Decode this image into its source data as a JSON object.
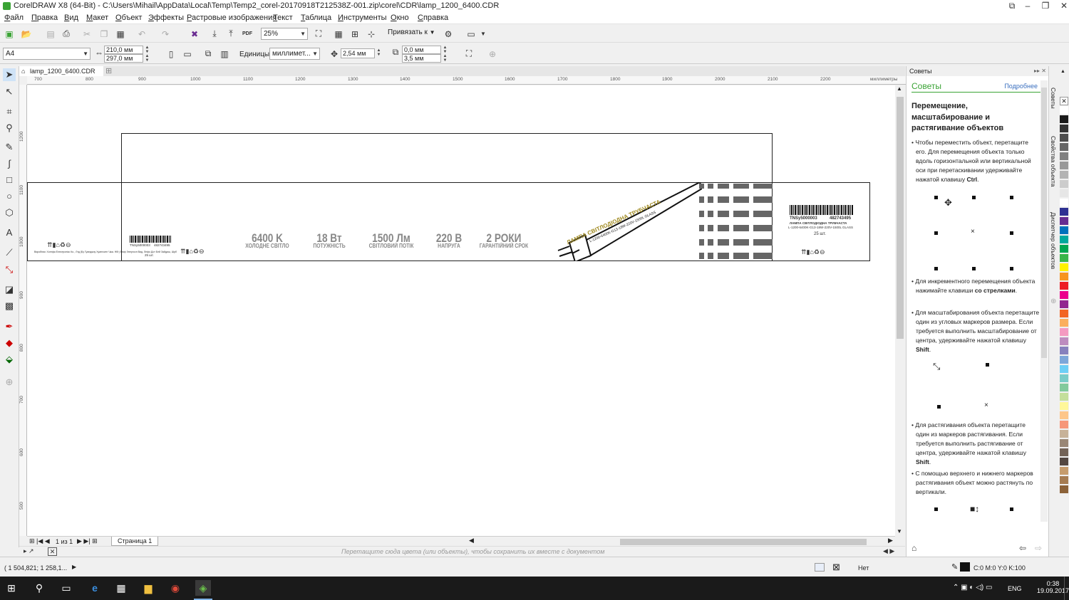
{
  "window": {
    "title": "CorelDRAW X8 (64-Bit) - C:\\Users\\Mihail\\AppData\\Local\\Temp\\Temp2_corel-20170918T212538Z-001.zip\\corel\\CDR\\lamp_1200_6400.CDR",
    "min": "–",
    "max": "☐",
    "close": "✕",
    "restore": "❐"
  },
  "menu": [
    "Файл",
    "Правка",
    "Вид",
    "Макет",
    "Объект",
    "Эффекты",
    "Растровые изображения",
    "Текст",
    "Таблица",
    "Инструменты",
    "Окно",
    "Справка"
  ],
  "toolbar": {
    "zoom": "25%",
    "snap": "Привязать к",
    "pdf": "PDF"
  },
  "property_bar": {
    "page_size": "A4",
    "width": "210,0 мм",
    "height": "297,0 мм",
    "units_label": "Единицы:",
    "units": "миллимет...",
    "nudge": "2,54 мм",
    "dup_x": "0,0 мм",
    "dup_y": "3,5 мм"
  },
  "doc_tab": "lamp_1200_6400.CDR",
  "ruler": {
    "h_ticks": [
      "700",
      "800",
      "900",
      "1000",
      "1100",
      "1200",
      "1300",
      "1400",
      "1500",
      "1600",
      "1700",
      "1800",
      "1900",
      "2000",
      "2100",
      "2200"
    ],
    "h_unit": "миллиметры",
    "v_ticks": [
      "1200",
      "1100",
      "1000",
      "900",
      "800",
      "700",
      "600",
      "500"
    ]
  },
  "artwork": {
    "specs": [
      {
        "big": "6400 K",
        "small": "ХОЛОДНЕ СВІТЛО"
      },
      {
        "big": "18 Вт",
        "small": "ПОТУЖНІСТЬ"
      },
      {
        "big": "1500 Лм",
        "small": "СВІТЛОВИЙ ПОТІК"
      },
      {
        "big": "220 В",
        "small": "НАПРУГА"
      },
      {
        "big": "2 РОКИ",
        "small": "ГАРАНТІЙНИЙ СРОК"
      }
    ],
    "tube_title": "ЛАМПА СВІТЛОДІОДНА ТРУБЧАСТА",
    "tube_sub": "L-1200-6400K-G13-18W-220V-1500L GLASS",
    "label_code": "TNSy5000003",
    "label_num": "482743495",
    "label_title": "ЛАМПА СВІТЛОДІОДНА ТРУБЧАСТА",
    "label_sub": "L-1200-6400K-G13-18W-220V-1500L GLASS",
    "label_qty": "25 шт.",
    "small_code": "TNSy5000003",
    "small_num": "482743495",
    "small_qty": "25 шт.",
    "maker": "Виробник: Хонгфа Електронікс Ко., Лтд (Бу Гуанджоу Хуангсинг Чжа. Нбг) Бюф Энергосп Вид, Лефо Дот Бей Зайдиш, Шрб"
  },
  "page_nav": {
    "counter": "1 из 1",
    "tab": "Страница 1"
  },
  "color_tray_hint": "Перетащите сюда цвета (или объекты), чтобы сохранить их вместе с документом",
  "status": {
    "coords": "( 1 504,821; 1 258,1...",
    "fill": "Нет",
    "outline": "C:0 M:0 Y:0 K:100"
  },
  "hints": {
    "panel": "Советы",
    "title": "Советы",
    "more": "Подробнее",
    "heading": "Перемещение, масштабирование и растягивание объектов",
    "p1_a": "• Чтобы переместить объект, перетащите его. Для перемещения объекта только вдоль горизонтальной или вертикальной оси при перетаскивании удерживайте нажатой клавишу ",
    "p1_b": "Ctrl",
    "p2_a": "• Для инкрементного перемещения объекта нажимайте клавиши ",
    "p2_b": "со стрелками",
    "p3_a": "• Для масштабирования объекта перетащите один из угловых маркеров размера. Если требуется выполнить масштабирование от центра, удерживайте нажатой клавишу ",
    "p3_b": "Shift",
    "p4_a": "• Для растягивания объекта перетащите один из маркеров растягивания. Если требуется выполнить растягивание от центра, удерживайте нажатой клавишу ",
    "p4_b": "Shift",
    "p5": "• С помощью верхнего и нижнего маркеров растягивания объект можно растянуть по вертикали."
  },
  "dock_tabs": [
    "Советы",
    "Свойства объекта",
    "Диспетчер объектов"
  ],
  "palette": [
    "#ffffff",
    "#1a1a1a",
    "#333333",
    "#4d4d4d",
    "#666666",
    "#808080",
    "#999999",
    "#b3b3b3",
    "#cccccc",
    "#e6e6e6",
    "#ffffff",
    "#2e3192",
    "#662d91",
    "#0072bc",
    "#00a99d",
    "#00a651",
    "#39b54a",
    "#fff200",
    "#f7941d",
    "#ed1c24",
    "#ec008c",
    "#92278f",
    "#f26522",
    "#fbaf5d",
    "#f49ac1",
    "#bd8cbf",
    "#8781bd",
    "#7da7d9",
    "#6dcff6",
    "#7accc8",
    "#82ca9c",
    "#c4df9b",
    "#fff799",
    "#fdc689",
    "#f69679",
    "#c7b299",
    "#998675",
    "#736357",
    "#534741",
    "#c69c6d",
    "#a67c52",
    "#8c6239"
  ],
  "taskbar": {
    "time": "0:38",
    "date": "19.09.2017",
    "lang": "ENG"
  }
}
